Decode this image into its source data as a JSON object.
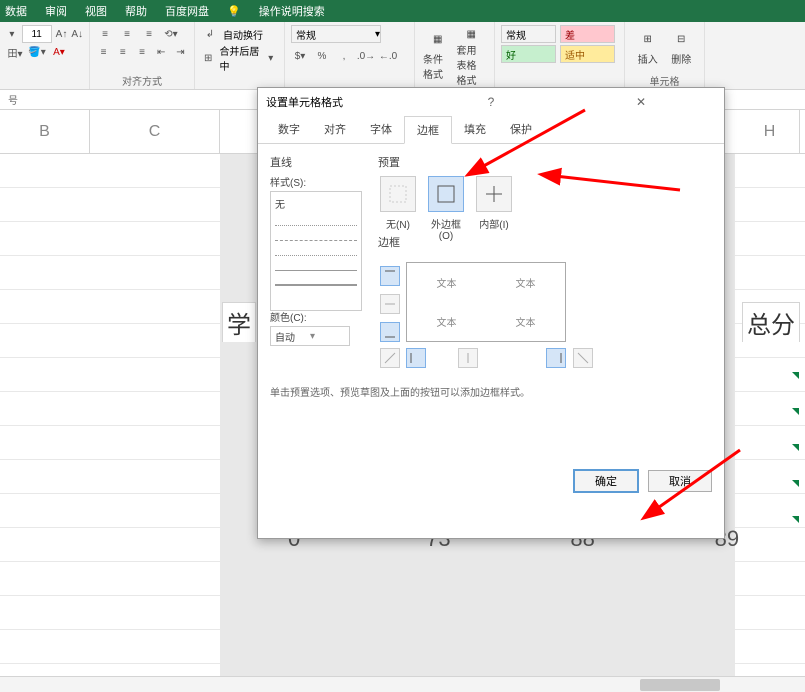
{
  "menu": {
    "items": [
      "数据",
      "审阅",
      "视图",
      "帮助",
      "百度网盘"
    ],
    "tell_me": "操作说明搜索"
  },
  "ribbon": {
    "font_size": "11",
    "alignment_group": "对齐方式",
    "wrap_text": "自动换行",
    "merge_center": "合并后居中",
    "number_format": "常规",
    "cond_format": "条件格式",
    "table_format": "套用表格格式",
    "styles": {
      "normal": "常规",
      "good": "好",
      "bad": "差",
      "neutral": "适中"
    },
    "insert": "插入",
    "delete": "删除",
    "cells_group": "单元格"
  },
  "formula_bar": {
    "label": "号"
  },
  "columns": {
    "B": "B",
    "C": "C",
    "H": "H"
  },
  "sheet": {
    "label_xue": "学",
    "label_zongfen": "总分",
    "numbers": [
      "0",
      "73",
      "88",
      "89"
    ]
  },
  "dialog": {
    "title": "设置单元格格式",
    "tabs": [
      "数字",
      "对齐",
      "字体",
      "边框",
      "填充",
      "保护"
    ],
    "active_tab": "边框",
    "line_section": "直线",
    "style_label": "样式(S):",
    "none_label": "无",
    "color_label": "颜色(C):",
    "color_value": "自动",
    "preset_section": "预置",
    "preset_none": "无(N)",
    "preset_outline": "外边框(O)",
    "preset_inside": "内部(I)",
    "border_section": "边框",
    "preview_text": "文本",
    "hint": "单击预置选项、预览草图及上面的按钮可以添加边框样式。",
    "ok": "确定",
    "cancel": "取消"
  }
}
